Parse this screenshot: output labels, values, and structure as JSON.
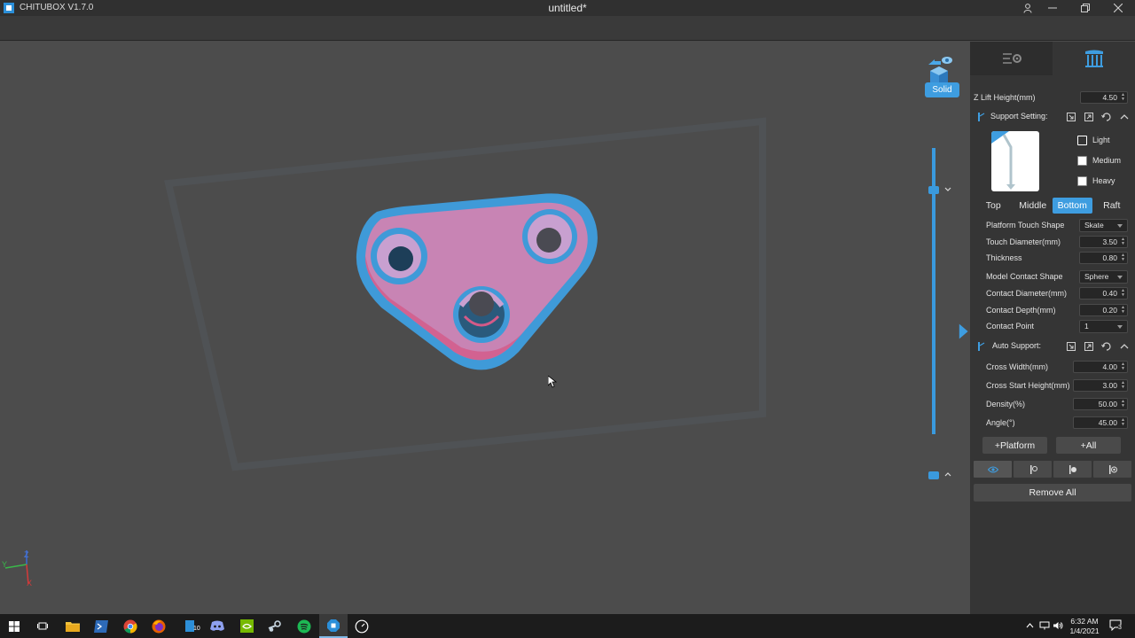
{
  "titlebar": {
    "app_name": "CHITUBOX V1.7.0",
    "doc_title": "untitled*"
  },
  "viewport": {
    "view_mode": "Solid",
    "axis_labels": {
      "x": "X",
      "y": "Y",
      "z": "Z"
    },
    "colors": {
      "model_top": "#c884b4",
      "model_edge": "#3f9ad8",
      "background": "#4c4c4c"
    }
  },
  "panel": {
    "z_lift": {
      "label": "Z Lift Height(mm)",
      "value": "4.50"
    },
    "support_setting": {
      "label": "Support Setting:"
    },
    "density_options": [
      "Light",
      "Medium",
      "Heavy"
    ],
    "subtabs": [
      "Top",
      "Middle",
      "Bottom",
      "Raft"
    ],
    "active_subtab": "Bottom",
    "bottom_fields": [
      {
        "label": "Platform Touch Shape",
        "value": "Skate"
      },
      {
        "label": "Touch Diameter(mm)",
        "value": "3.50"
      },
      {
        "label": "Thickness",
        "value": "0.80"
      },
      {
        "label": "Model Contact Shape",
        "value": "Sphere"
      },
      {
        "label": "Contact Diameter(mm)",
        "value": "0.40"
      },
      {
        "label": "Contact Depth(mm)",
        "value": "0.20"
      },
      {
        "label": "Contact Point",
        "value": "1"
      }
    ],
    "auto_support": {
      "label": "Auto Support:"
    },
    "auto_fields": [
      {
        "label": "Cross Width(mm)",
        "value": "4.00"
      },
      {
        "label": "Cross Start Height(mm)",
        "value": "3.00"
      },
      {
        "label": "Density(%)",
        "value": "50.00"
      },
      {
        "label": "Angle(°)",
        "value": "45.00"
      }
    ],
    "platform_button": "+Platform",
    "all_button": "+All",
    "remove_all_button": "Remove All",
    "accent_color": "#3e9de0"
  },
  "taskbar": {
    "time": "6:32 AM",
    "date": "1/4/2021",
    "notification_count": "3",
    "badge_text": "10"
  }
}
